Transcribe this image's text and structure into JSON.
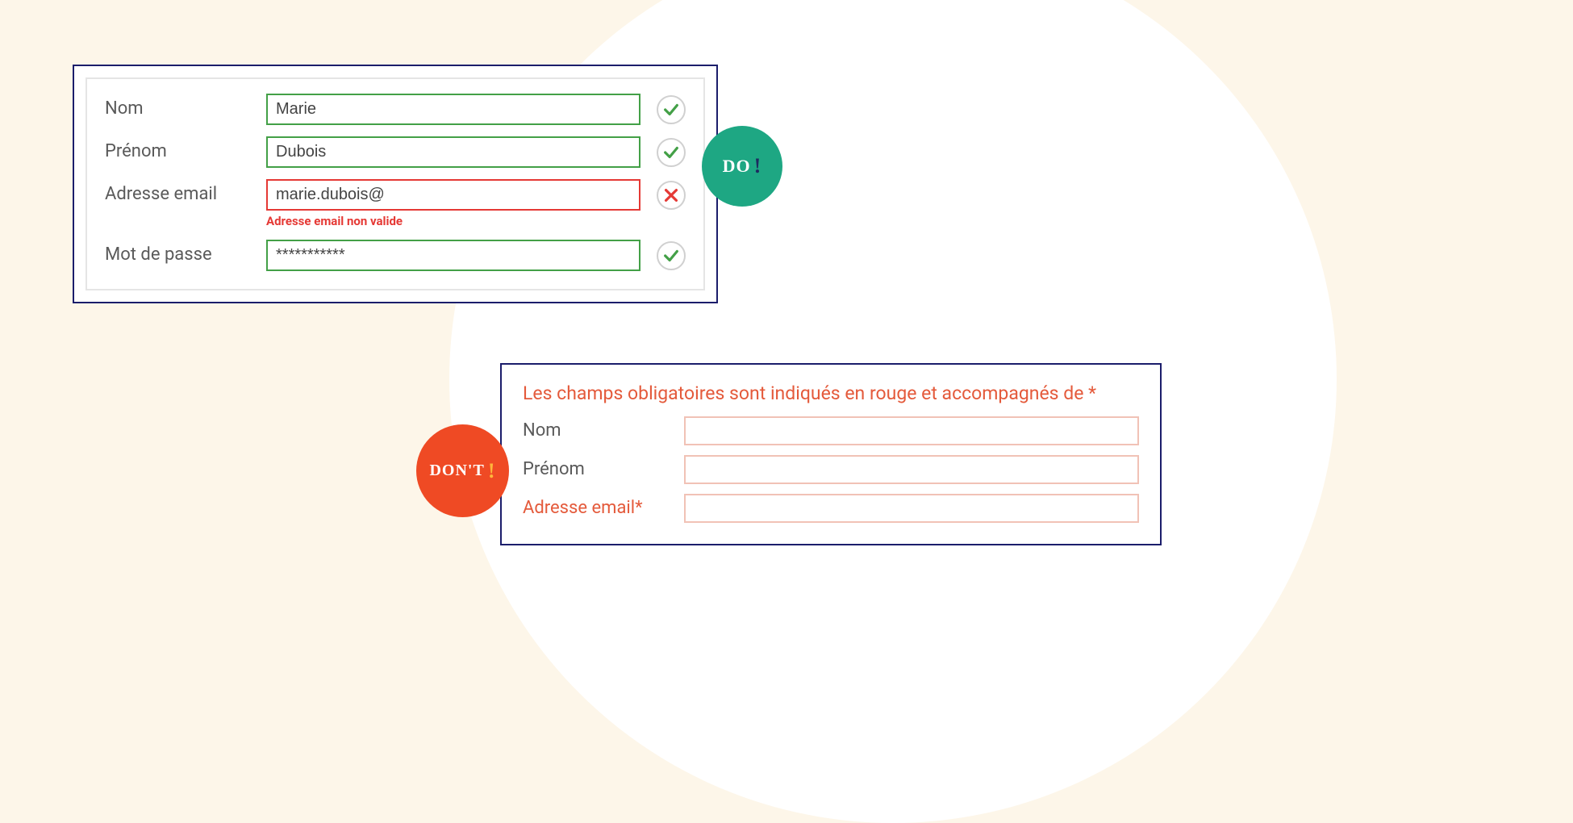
{
  "badges": {
    "do": "DO",
    "dont": "DON'T"
  },
  "do_form": {
    "fields": [
      {
        "label": "Nom",
        "value": "Marie",
        "status": "valid"
      },
      {
        "label": "Prénom",
        "value": "Dubois",
        "status": "valid"
      },
      {
        "label": "Adresse email",
        "value": "marie.dubois@",
        "status": "invalid",
        "error": "Adresse email non valide"
      },
      {
        "label": "Mot de passe",
        "value": "***********",
        "status": "valid"
      }
    ]
  },
  "dont_form": {
    "heading": "Les champs obligatoires sont indiqués en rouge et accompagnés de *",
    "fields": [
      {
        "label": "Nom"
      },
      {
        "label": "Prénom"
      },
      {
        "label": "Adresse email*",
        "required": true
      }
    ]
  },
  "colors": {
    "valid": "#43a047",
    "invalid": "#e53935",
    "do_badge": "#1ea783",
    "dont_badge": "#ef4a24",
    "panel_border": "#1b1d6b"
  }
}
